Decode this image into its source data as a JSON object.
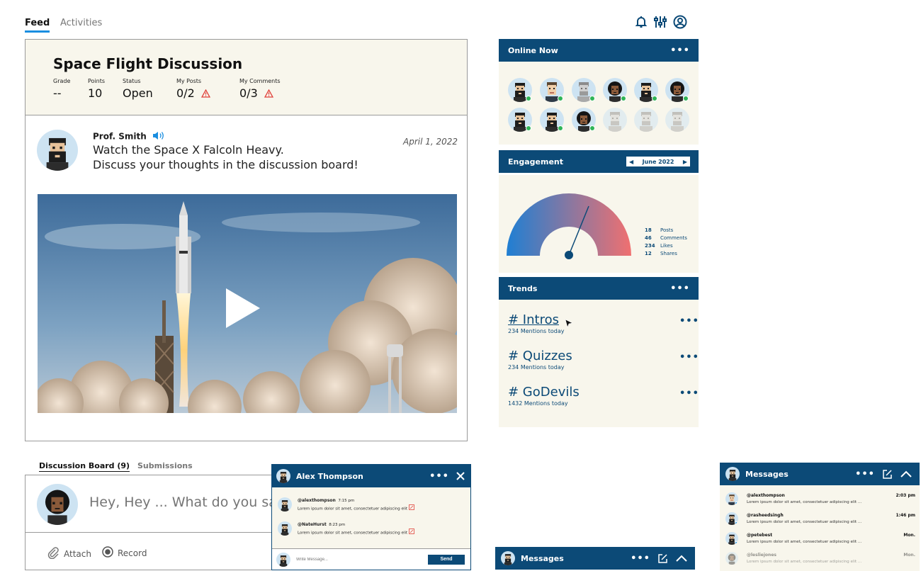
{
  "nav": {
    "tabs": [
      {
        "label": "Feed",
        "active": true
      },
      {
        "label": "Activities",
        "active": false
      }
    ],
    "icons": [
      "bell-icon",
      "sliders-icon",
      "profile-icon"
    ]
  },
  "course": {
    "title": "Space Flight Discussion",
    "stats": [
      {
        "label": "Grade",
        "value": "--"
      },
      {
        "label": "Points",
        "value": "10"
      },
      {
        "label": "Status",
        "value": "Open"
      },
      {
        "label": "My Posts",
        "value": "0/2",
        "warning": true
      },
      {
        "label": "My Comments",
        "value": "0/3",
        "warning": true
      }
    ]
  },
  "post": {
    "author": "Prof. Smith",
    "date": "April 1, 2022",
    "line1": "Watch the Space X Falcoln Heavy.",
    "line2": "Discuss your thoughts in the discussion board!"
  },
  "discussion": {
    "tabs": [
      {
        "label": "Discussion Board (9)",
        "active": true
      },
      {
        "label": "Submissions",
        "active": false
      }
    ],
    "placeholder": "Hey, Hey ... What do you say?",
    "attach_label": "Attach",
    "record_label": "Record"
  },
  "chat": {
    "name": "Alex Thompson",
    "messages": [
      {
        "user": "@alexthompson",
        "time": "7:15 pm",
        "text": "Lorem ipsum dolor sit amet, consectetuer adipiscing elit"
      },
      {
        "user": "@NateHurst",
        "time": "8:23 pm",
        "text": "Lorem ipsum dolor sit amet, consectetuer adipiscing elit"
      }
    ],
    "input_placeholder": "Write Message...",
    "send_label": "Send"
  },
  "online": {
    "title": "Online Now"
  },
  "engagement": {
    "title": "Engagement",
    "month": "June 2022",
    "stats": [
      {
        "value": "18",
        "label": "Posts"
      },
      {
        "value": "46",
        "label": "Comments"
      },
      {
        "value": "234",
        "label": "Likes"
      },
      {
        "value": "12",
        "label": "Shares"
      }
    ],
    "colors": {
      "start": "#1f7fd3",
      "end": "#f07070"
    }
  },
  "trends": {
    "title": "Trends",
    "items": [
      {
        "tag": "# Intros",
        "count": "234 Mentions today"
      },
      {
        "tag": "# Quizzes",
        "count": "234 Mentions today"
      },
      {
        "tag": "# GoDevils",
        "count": "1432 Mentions today"
      }
    ]
  },
  "messages_bar": {
    "title": "Messages"
  },
  "messages_panel": {
    "title": "Messages",
    "items": [
      {
        "user": "@alexthompson",
        "text": "Lorem ipsum dolor sit amet, consectetuer adipiscing elit ...",
        "time": "2:03 pm"
      },
      {
        "user": "@rasheedsingh",
        "text": "Lorem ipsum dolor sit amet, consectetuer adipiscing elit ...",
        "time": "1:46 pm"
      },
      {
        "user": "@petebest",
        "text": "Lorem ipsum dolor sit amet, consectetuer adipiscing elit ...",
        "time": "Mon."
      },
      {
        "user": "@lesliejones",
        "text": "Lorem ipsum dolor sit amet, consectetuer adipiscing elit ...",
        "time": "Mon."
      }
    ]
  },
  "colors": {
    "accent": "#0c4a77",
    "tab_underline": "#1a8ee0",
    "panel_bg": "#f8f6ec",
    "online_dot": "#2fb457",
    "warning": "#e0413a"
  }
}
